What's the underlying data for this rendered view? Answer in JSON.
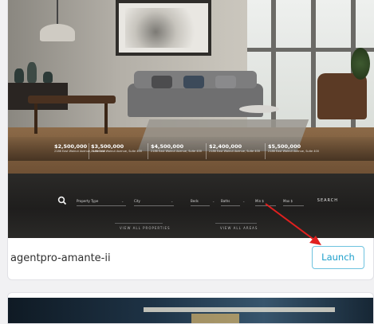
{
  "card": {
    "app_name": "agentpro-amante-ii",
    "launch_label": "Launch",
    "preview": {
      "property_cards": [
        {
          "price": "$2,500,000",
          "address": "2186 East Walnut Avenue, Suite 400"
        },
        {
          "price": "$3,500,000",
          "address": "2186 East Walnut Avenue, Suite 400"
        },
        {
          "price": "$4,500,000",
          "address": "2186 East Walnut Avenue, Suite 400"
        },
        {
          "price": "$2,400,000",
          "address": "2186 East Walnut Avenue, Suite 400"
        },
        {
          "price": "$5,500,000",
          "address": "2186 East Walnut Avenue, Suite 400"
        }
      ],
      "search_fields": [
        "Property Type",
        "City",
        "Beds",
        "Baths",
        "Min $",
        "Max $"
      ],
      "search_button": "SEARCH",
      "view_all_properties": "VIEW ALL PROPERTIES",
      "view_all_areas": "VIEW ALL AREAS"
    }
  },
  "colors": {
    "accent": "#1d9fcb",
    "accent_border": "#6ec3df",
    "annotation_arrow": "#e0201f"
  }
}
